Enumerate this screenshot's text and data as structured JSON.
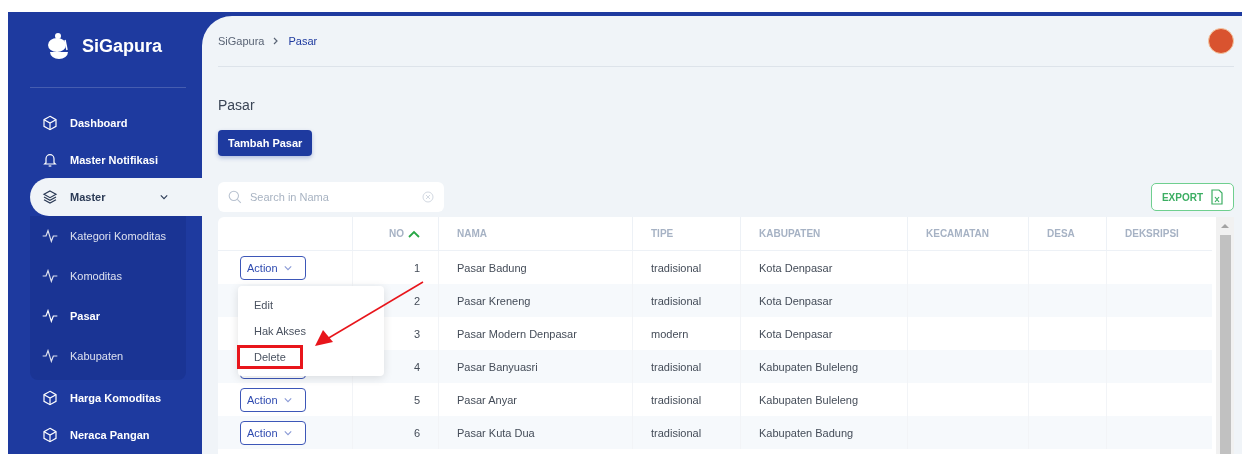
{
  "brand": {
    "name": "SiGapura"
  },
  "sidebar": {
    "items": [
      {
        "label": "Dashboard",
        "kind": "box",
        "selected": false
      },
      {
        "label": "Master Notifikasi",
        "kind": "bell",
        "selected": false
      },
      {
        "label": "Master",
        "kind": "layers",
        "selected": true,
        "expanded": true,
        "children": [
          {
            "label": "Kategori Komoditas",
            "selected": false
          },
          {
            "label": "Komoditas",
            "selected": false
          },
          {
            "label": "Pasar",
            "selected": true
          },
          {
            "label": "Kabupaten",
            "selected": false
          }
        ]
      },
      {
        "label": "Harga Komoditas",
        "kind": "box",
        "selected": false
      },
      {
        "label": "Neraca Pangan",
        "kind": "box",
        "selected": false
      }
    ]
  },
  "breadcrumb": [
    {
      "label": "SiGapura",
      "selected": false
    },
    {
      "label": "Pasar",
      "selected": true
    }
  ],
  "page_title": "Pasar",
  "add_button": "Tambah Pasar",
  "search": {
    "placeholder": "Search in Nama"
  },
  "export_button": "EXPORT",
  "table": {
    "columns": [
      {
        "label": "NO",
        "sorted": true
      },
      {
        "label": "NAMA",
        "sorted": false
      },
      {
        "label": "TIPE",
        "sorted": false
      },
      {
        "label": "KABUPATEN",
        "sorted": false
      },
      {
        "label": "KECAMATAN",
        "sorted": false
      },
      {
        "label": "DESA",
        "sorted": false
      },
      {
        "label": "DEKSRIPSI",
        "sorted": false
      }
    ],
    "rows": [
      {
        "action_button": true,
        "action_label": "Action",
        "cells": [
          "1",
          "Pasar Badung",
          "tradisional",
          "Kota Denpasar",
          "",
          "",
          ""
        ]
      },
      {
        "action_button": false,
        "cells": [
          "2",
          "Pasar Kreneng",
          "tradisional",
          "Kota Denpasar",
          "",
          "",
          ""
        ]
      },
      {
        "action_button": false,
        "cells": [
          "3",
          "Pasar Modern Denpasar",
          "modern",
          "Kota Denpasar",
          "",
          "",
          ""
        ]
      },
      {
        "action_button": true,
        "cells": [
          "4",
          "Pasar Banyuasri",
          "tradisional",
          "Kabupaten Buleleng",
          "",
          "",
          ""
        ]
      },
      {
        "action_button": true,
        "action_label": "Action",
        "cells": [
          "5",
          "Pasar Anyar",
          "tradisional",
          "Kabupaten Buleleng",
          "",
          "",
          ""
        ]
      },
      {
        "action_button": true,
        "action_label": "Action",
        "cells": [
          "6",
          "Pasar Kuta Dua",
          "tradisional",
          "Kabupaten Badung",
          "",
          "",
          ""
        ]
      }
    ]
  },
  "action_menu": {
    "items": [
      {
        "label": "Edit",
        "highlighted": false
      },
      {
        "label": "Hak Akses",
        "highlighted": false
      },
      {
        "label": "Delete",
        "highlighted": true
      }
    ],
    "pointer_arrow": true
  }
}
